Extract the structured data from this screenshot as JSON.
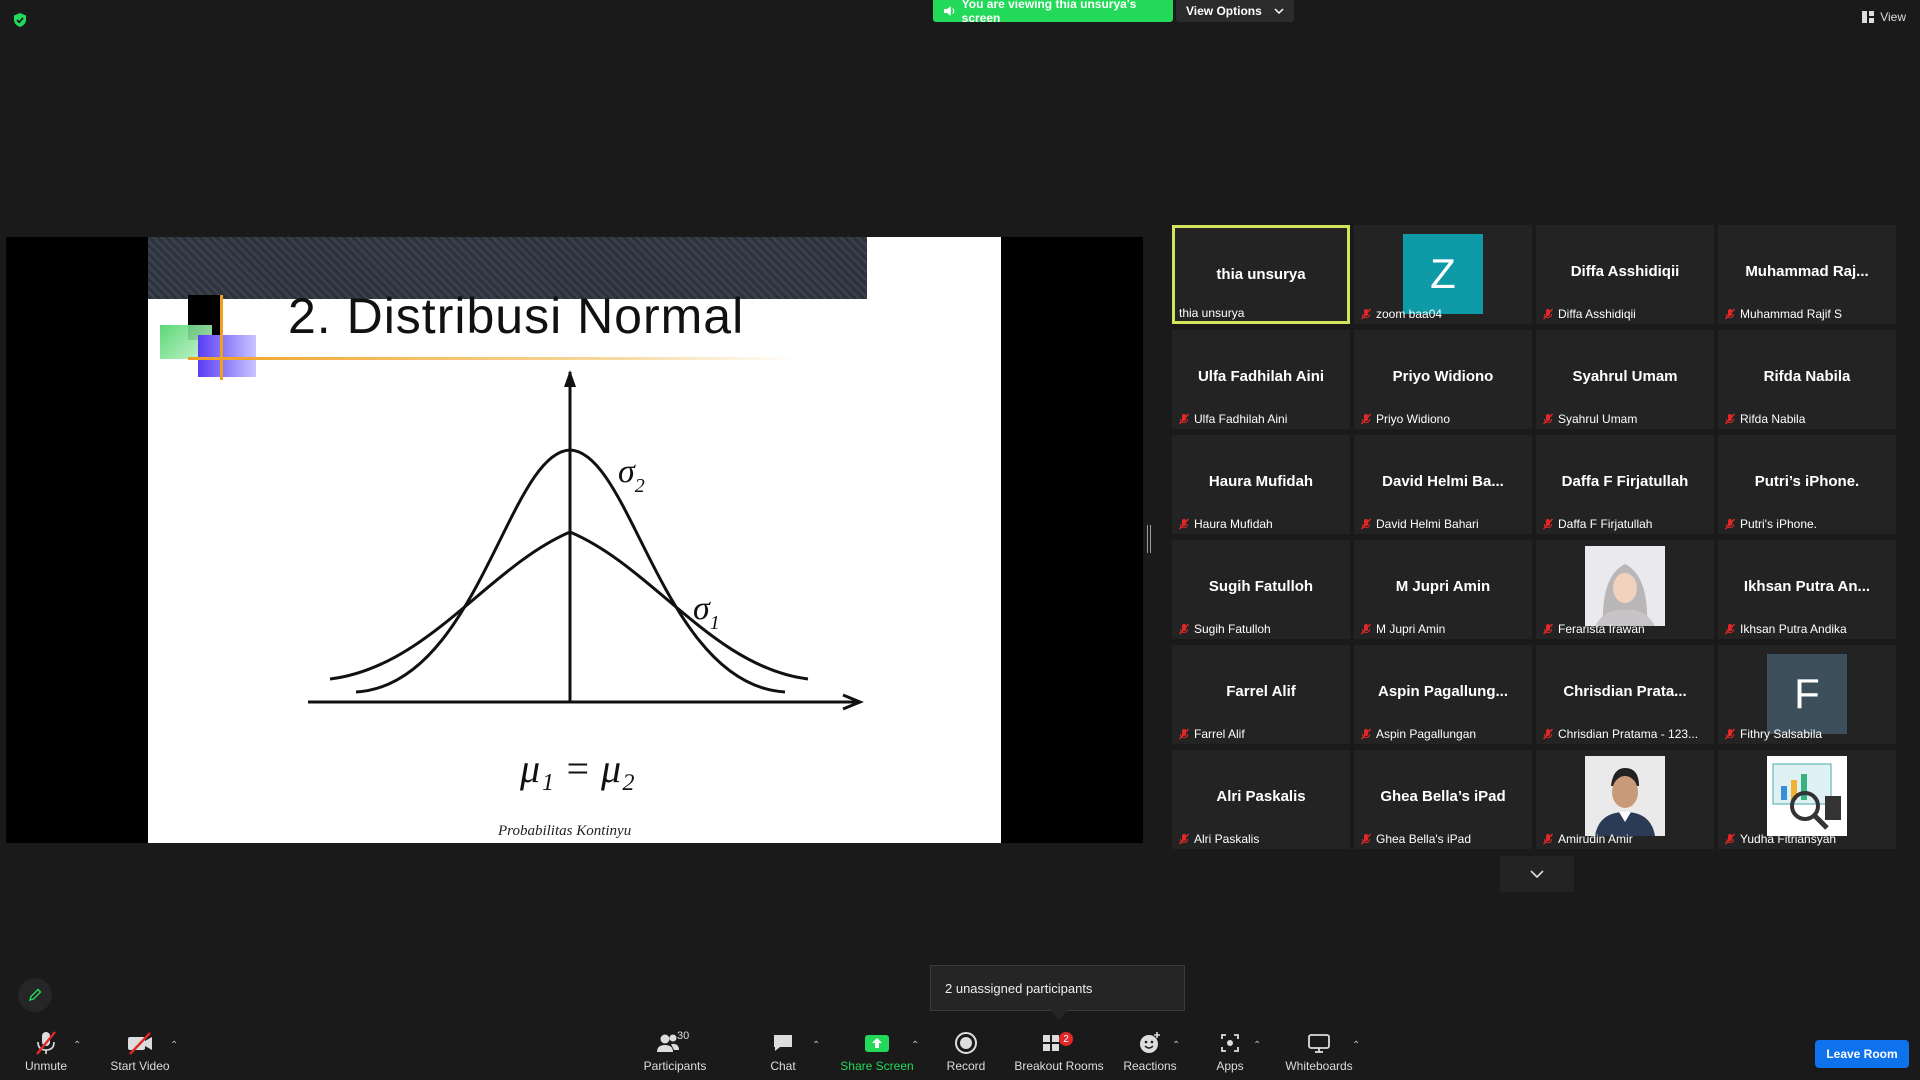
{
  "top": {
    "viewing_banner": "You are viewing thia unsurya's screen",
    "view_options": "View Options",
    "view": "View"
  },
  "slide": {
    "title": "2. Distribusi Normal",
    "sigma2": "σ",
    "sigma2_sub": "2",
    "sigma1": "σ",
    "sigma1_sub": "1",
    "equation": "μ₁ = μ₂",
    "footer": "Probabilitas Kontinyu"
  },
  "gallery": {
    "tiles": [
      {
        "display": "thia unsurya",
        "label": "thia unsurya",
        "muted": false,
        "active": true
      },
      {
        "display": "",
        "label": "zoom baa04",
        "muted": true,
        "avatar_letter": "Z",
        "avatar_color": "#0e9aa7"
      },
      {
        "display": "Diffa Asshidiqii",
        "label": "Diffa Asshidiqii",
        "muted": true
      },
      {
        "display": "Muhammad  Raj...",
        "label": "Muhammad Rajif S",
        "muted": true
      },
      {
        "display": "Ulfa Fadhilah Aini",
        "label": "Ulfa Fadhilah Aini",
        "muted": true
      },
      {
        "display": "Priyo Widiono",
        "label": "Priyo Widiono",
        "muted": true
      },
      {
        "display": "Syahrul Umam",
        "label": "Syahrul Umam",
        "muted": true
      },
      {
        "display": "Rifda Nabila",
        "label": "Rifda Nabila",
        "muted": true
      },
      {
        "display": "Haura Mufidah",
        "label": "Haura Mufidah",
        "muted": true
      },
      {
        "display": "David  Helmi  Ba...",
        "label": "David Helmi Bahari",
        "muted": true
      },
      {
        "display": "Daffa F Firjatullah",
        "label": "Daffa F Firjatullah",
        "muted": true
      },
      {
        "display": "Putri’s iPhone.",
        "label": "Putri's iPhone.",
        "muted": true
      },
      {
        "display": "Sugih Fatulloh",
        "label": "Sugih Fatulloh",
        "muted": true
      },
      {
        "display": "M Jupri Amin",
        "label": "M Jupri Amin",
        "muted": true
      },
      {
        "display": "",
        "label": "Ferarista Irawan",
        "muted": true,
        "photo": "hijab"
      },
      {
        "display": "Ikhsan Putra An...",
        "label": "Ikhsan Putra Andika",
        "muted": true
      },
      {
        "display": "Farrel Alif",
        "label": "Farrel Alif",
        "muted": true
      },
      {
        "display": "Aspin  Pagallung...",
        "label": "Aspin Pagallungan",
        "muted": true
      },
      {
        "display": "Chrisdian  Prata...",
        "label": "Chrisdian Pratama - 123...",
        "muted": true
      },
      {
        "display": "",
        "label": "Fithry Salsabila",
        "muted": true,
        "avatar_letter": "F",
        "avatar_color": "#3d4f5a"
      },
      {
        "display": "Alri Paskalis",
        "label": "Alri Paskalis",
        "muted": true
      },
      {
        "display": "Ghea Bella’s iPad",
        "label": "Ghea Bella's iPad",
        "muted": true
      },
      {
        "display": "",
        "label": "Amirudin Amir",
        "muted": true,
        "photo": "man"
      },
      {
        "display": "",
        "label": "Yudha Fitriansyah",
        "muted": true,
        "photo": "chart"
      }
    ]
  },
  "notification": {
    "text": "2 unassigned participants"
  },
  "toolbar": {
    "unmute": "Unmute",
    "start_video": "Start Video",
    "participants": "Participants",
    "participants_count": "30",
    "chat": "Chat",
    "share_screen": "Share Screen",
    "record": "Record",
    "breakout_rooms": "Breakout Rooms",
    "breakout_badge": "2",
    "reactions": "Reactions",
    "apps": "Apps",
    "whiteboards": "Whiteboards",
    "leave_room": "Leave Room"
  },
  "colors": {
    "share_green": "#23d959",
    "active_border": "#d4e45a",
    "leave_blue": "#0e72ed",
    "mute_red": "#e02828"
  }
}
